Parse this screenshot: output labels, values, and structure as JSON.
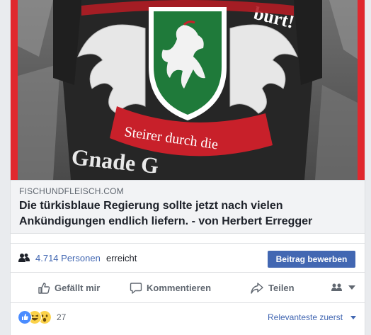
{
  "post": {
    "image": {
      "description_icon": "shirt-with-styrian-panther-crest-image",
      "banner_text_1": "Steirer durch die",
      "banner_text_2": "Gnade G",
      "top_text": "burt!"
    },
    "link_domain": "FISCHUNDFLEISCH.COM",
    "link_headline": "Die türkisblaue Regierung sollte jetzt nach vielen Ankündigungen endlich liefern. - von Herbert Erregger"
  },
  "reach": {
    "icon": "people-icon",
    "count": "4.714 Personen",
    "suffix": "erreicht",
    "boost_label": "Beitrag bewerben"
  },
  "actions": {
    "like_label": "Gefällt mir",
    "comment_label": "Kommentieren",
    "share_label": "Teilen",
    "audience_icon": "audience-selector-icon"
  },
  "reactions": {
    "types": [
      "like",
      "haha",
      "wow"
    ],
    "count": "27",
    "sort_label": "Relevanteste zuerst"
  },
  "colors": {
    "link": "#4267b2",
    "shirt_green": "#1f7a3a",
    "banner_red": "#c8202a",
    "border_red": "#e0282e"
  }
}
